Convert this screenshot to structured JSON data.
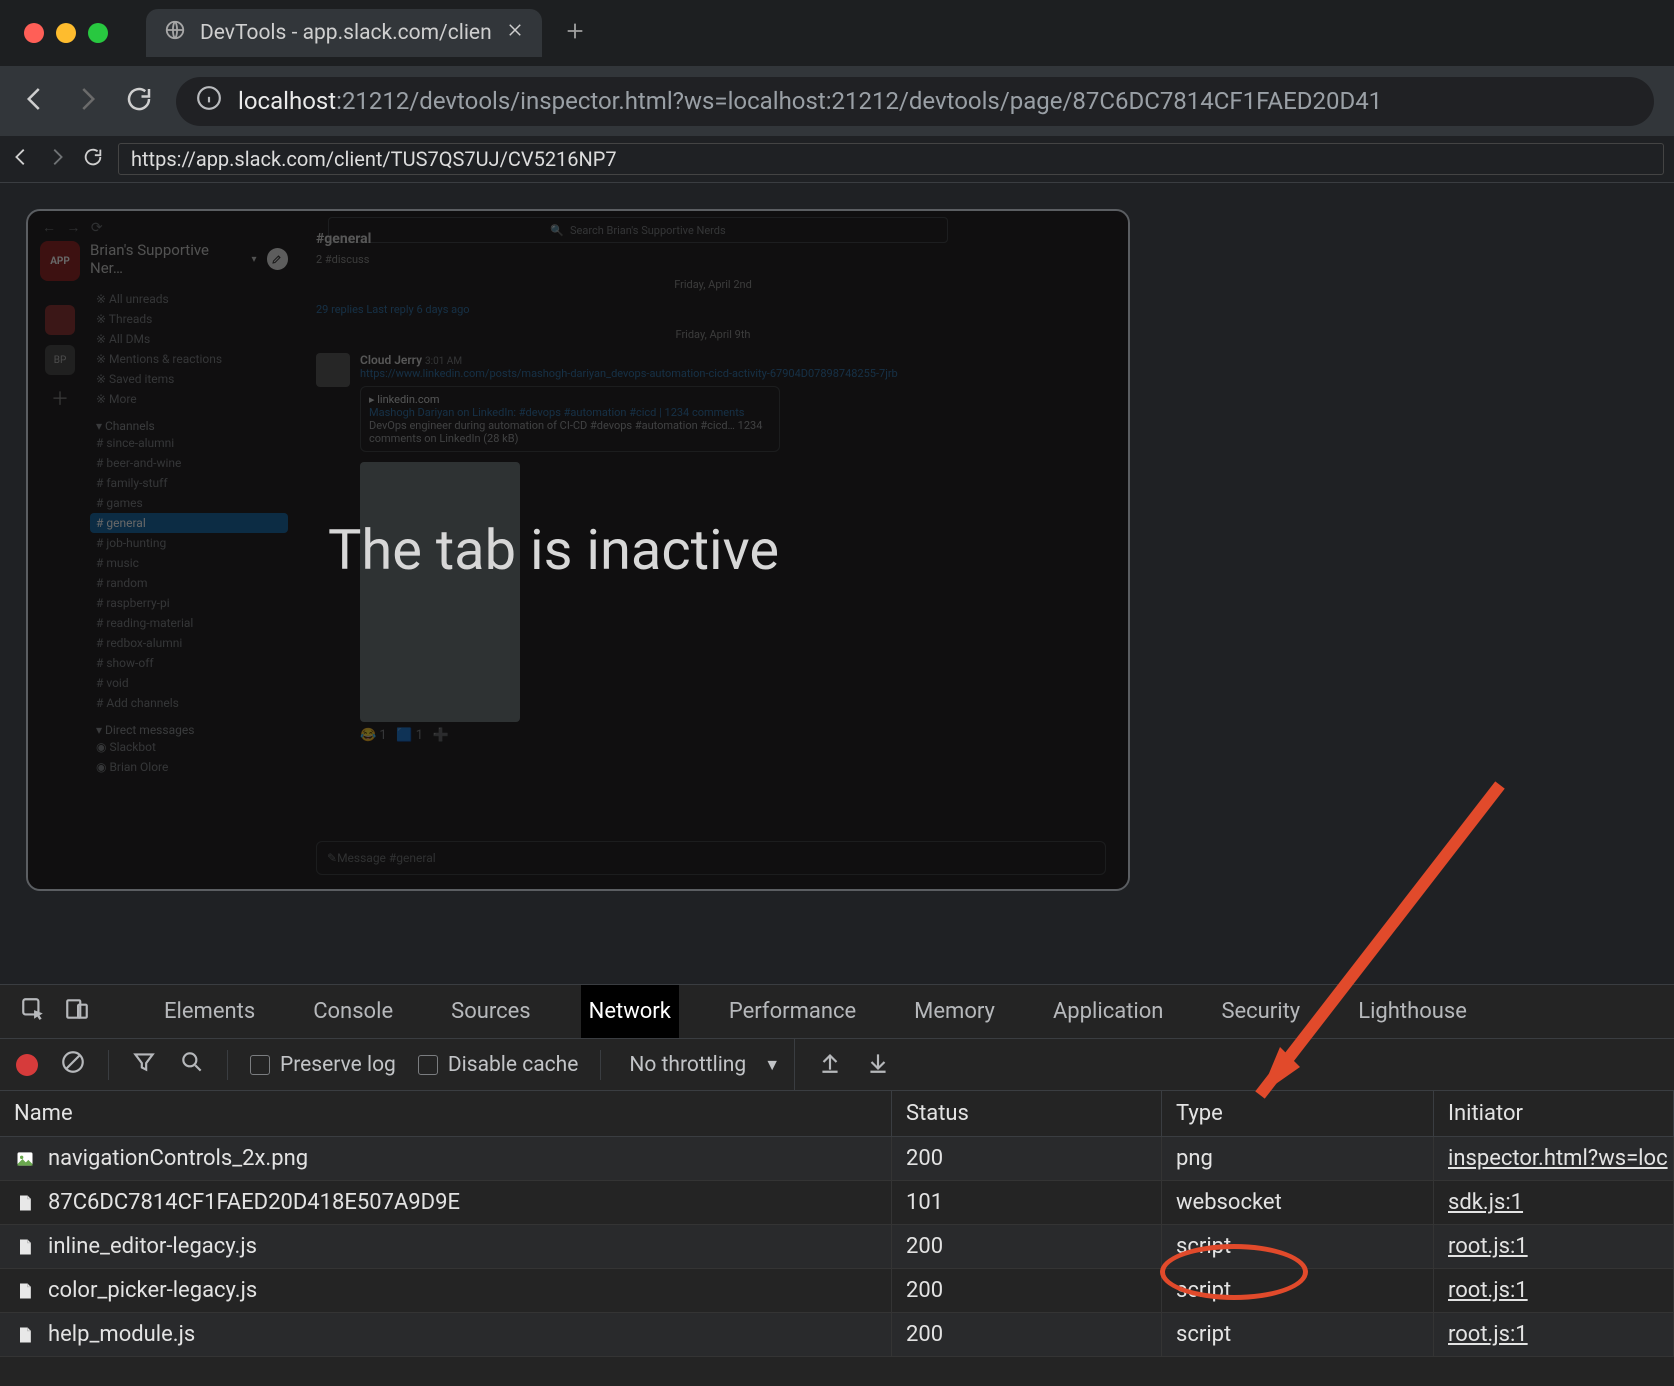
{
  "browser": {
    "tab_title": "DevTools - app.slack.com/clien",
    "url_prefix": "localhost",
    "url_rest": ":21212/devtools/inspector.html?ws=localhost:21212/devtools/page/87C6DC7814CF1FAED20D41"
  },
  "traffic_colors": {
    "close": "#ff5f57",
    "min": "#febc2e",
    "max": "#28c840"
  },
  "devtools_inner": {
    "url": "https://app.slack.com/client/TUS7QS7UJ/CV5216NP7"
  },
  "preview": {
    "overlay_text": "The tab is inactive",
    "workspace_badge": "APP",
    "workspace_name": "Brian's Supportive Ner…",
    "search_placeholder": "Search Brian's Supportive Nerds",
    "top_items": [
      "All unreads",
      "Threads",
      "All DMs",
      "Mentions & reactions",
      "Saved items",
      "More"
    ],
    "channels_label": "Channels",
    "channels": [
      "since-alumni",
      "beer-and-wine",
      "family-stuff",
      "games",
      "general",
      "job-hunting",
      "music",
      "random",
      "raspberry-pi",
      "reading-material",
      "redbox-alumni",
      "show-off",
      "void",
      "Add channels"
    ],
    "selected_channel_index": 4,
    "dms_label": "Direct messages",
    "dms": [
      "Slackbot",
      "Brian Olore"
    ],
    "channel_header": "#general",
    "channel_sub": "2   #discuss",
    "divider1": "Friday, April 2nd",
    "thread_line": "29 replies   Last reply 6 days ago",
    "divider2": "Friday, April 9th",
    "msg_user": "Cloud Jerry",
    "msg_time": "3:01 AM",
    "msg_link": "https://www.linkedin.com/posts/mashogh-dariyan_devops-automation-cicd-activity-67904D07898748255-7jrb",
    "card_site": "linkedin.com",
    "card_title": "Mashogh Dariyan on LinkedIn: #devops #automation #cicd | 1234 comments",
    "card_body": "DevOps engineer during automation of CI-CD #devops #automation #cicd… 1234 comments on LinkedIn (28 kB)",
    "compose_placeholder": "Message #general"
  },
  "devtools": {
    "tabs": [
      "Elements",
      "Console",
      "Sources",
      "Network",
      "Performance",
      "Memory",
      "Application",
      "Security",
      "Lighthouse"
    ],
    "active_tab_index": 3,
    "subbar": {
      "preserve_log": "Preserve log",
      "disable_cache": "Disable cache",
      "throttle": "No throttling"
    },
    "columns": [
      "Name",
      "Status",
      "Type",
      "Initiator"
    ],
    "rows": [
      {
        "icon": "image",
        "name": "navigationControls_2x.png",
        "status": "200",
        "type": "png",
        "initiator": "inspector.html?ws=loc"
      },
      {
        "icon": "doc",
        "name": "87C6DC7814CF1FAED20D418E507A9D9E",
        "status": "101",
        "type": "websocket",
        "initiator": "sdk.js:1"
      },
      {
        "icon": "doc",
        "name": "inline_editor-legacy.js",
        "status": "200",
        "type": "script",
        "initiator": "root.js:1"
      },
      {
        "icon": "doc",
        "name": "color_picker-legacy.js",
        "status": "200",
        "type": "script",
        "initiator": "root.js:1"
      },
      {
        "icon": "doc",
        "name": "help_module.js",
        "status": "200",
        "type": "script",
        "initiator": "root.js:1"
      }
    ]
  }
}
